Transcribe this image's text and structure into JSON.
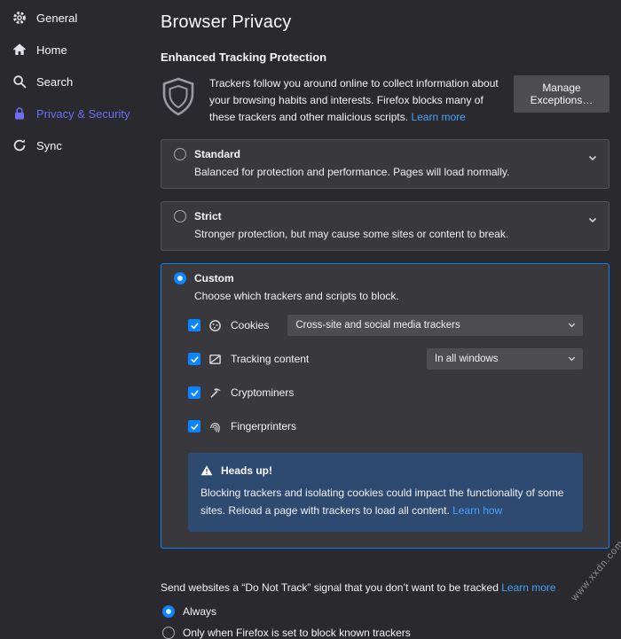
{
  "colors": {
    "accent": "#0a84ff",
    "link": "#45a1ff",
    "active_category": "#6d6df7",
    "card_background": "#38383d",
    "info_background": "#2e4a70",
    "page_background": "#2a2a2e"
  },
  "sidebar": {
    "items": [
      {
        "label": "General"
      },
      {
        "label": "Home"
      },
      {
        "label": "Search"
      },
      {
        "label": "Privacy & Security"
      },
      {
        "label": "Sync"
      }
    ]
  },
  "main": {
    "title": "Browser Privacy",
    "etp": {
      "heading": "Enhanced Tracking Protection",
      "description": "Trackers follow you around online to collect information about your browsing habits and interests. Firefox blocks many of these trackers and other malicious scripts.",
      "learn_more_label": "Learn more",
      "manage_exceptions_label": "Manage Exceptions…",
      "standard": {
        "label": "Standard",
        "description": "Balanced for protection and performance. Pages will load normally.",
        "selected": false
      },
      "strict": {
        "label": "Strict",
        "description": "Stronger protection, but may cause some sites or content to break.",
        "selected": false
      },
      "custom": {
        "label": "Custom",
        "description": "Choose which trackers and scripts to block.",
        "selected": true,
        "cookies_label": "Cookies",
        "cookies_checked": true,
        "cookies_selected_option": "Cross-site and social media trackers",
        "tracking_label": "Tracking content",
        "tracking_checked": true,
        "tracking_selected_option": "In all windows",
        "cryptominers_label": "Cryptominers",
        "cryptominers_checked": true,
        "fingerprinters_label": "Fingerprinters",
        "fingerprinters_checked": true
      },
      "warning": {
        "title": "Heads up!",
        "text": "Blocking trackers and isolating cookies could impact the functionality of some sites. Reload a page with trackers to load all content.",
        "link_label": "Learn how"
      }
    },
    "dnt": {
      "label": "Send websites a “Do Not Track” signal that you don’t want to be tracked",
      "learn_more_label": "Learn more",
      "options": [
        {
          "label": "Always",
          "selected": true
        },
        {
          "label": "Only when Firefox is set to block known trackers",
          "selected": false
        }
      ]
    }
  },
  "watermark": "www.xxdn.com"
}
